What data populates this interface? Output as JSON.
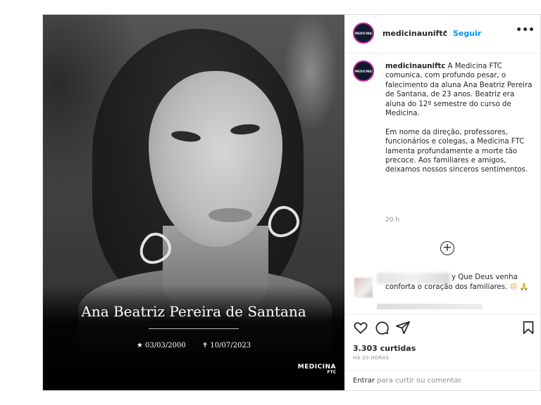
{
  "account": {
    "username": "medicinauniftc",
    "avatar_text": "MEDICINA",
    "follow_label": "Seguir",
    "separator": "•"
  },
  "photo": {
    "name": "Ana Beatriz Pereira de Santana",
    "birth_date": "★ 03/03/2000",
    "death_date": "✝ 10/07/2023",
    "logo_line1": "MEDICINA",
    "logo_line2": "FTC"
  },
  "caption": {
    "username": "medicinauniftc",
    "text": " A Medicina FTC comunica, com profundo pesar, o falecimento da aluna Ana Beatriz Pereira de Santana, de 23 anos. Beatriz era aluna do 12º semestre do curso de Medicina.\n\nEm nome da direção, professores, funcionários e colegas, a Medicina FTC lamenta profundamente a morte tão precoce. Aos familiares e amigos, deixamos nossos sinceros sentimentos.",
    "time": "20 h"
  },
  "comment": {
    "line1": "y Que Deus venha",
    "line2": "conforta o coração dos familiares.",
    "emojis": "😢 🙏"
  },
  "footer": {
    "likes": "3.303 curtidas",
    "posted": "HÁ 20 HORAS",
    "login_link": "Entrar",
    "login_rest": " para curtir ou comentar."
  },
  "icons": {
    "more": "more-options-icon",
    "plus": "load-more-comments-icon",
    "like": "heart-icon",
    "comment": "comment-icon",
    "share": "share-icon",
    "save": "bookmark-icon"
  },
  "colors": {
    "accent": "#0095f6",
    "text": "#262626",
    "muted": "#8e8e8e",
    "border": "#dbdbdb"
  }
}
